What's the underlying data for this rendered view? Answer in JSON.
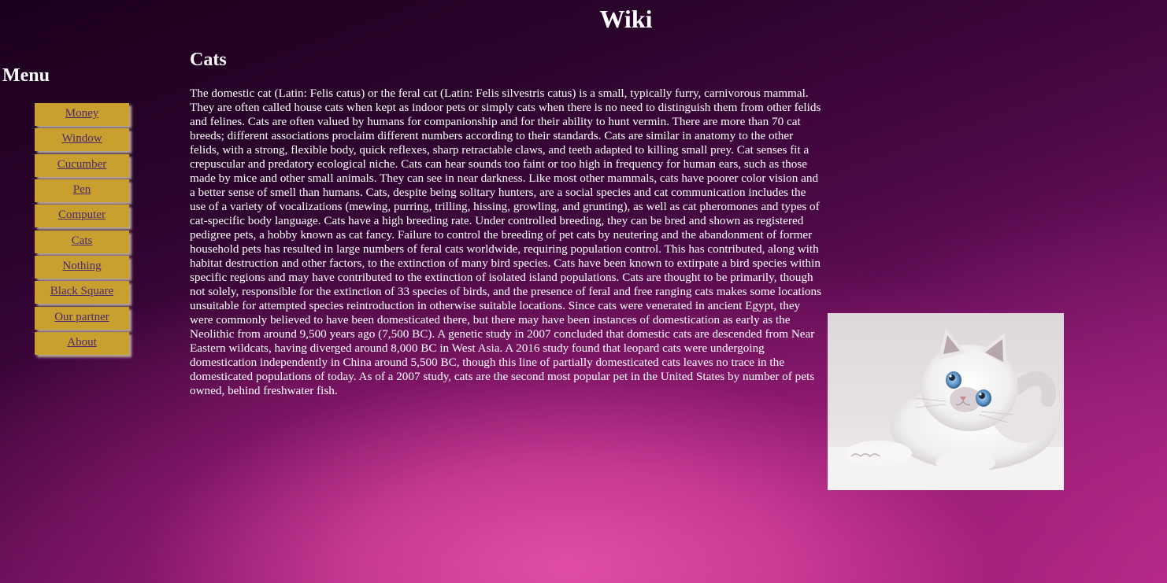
{
  "site": {
    "title": "Wiki"
  },
  "menu": {
    "heading": "Menu",
    "items": [
      {
        "label": "Money"
      },
      {
        "label": "Window"
      },
      {
        "label": "Cucumber"
      },
      {
        "label": "Pen"
      },
      {
        "label": "Computer"
      },
      {
        "label": "Cats"
      },
      {
        "label": "Nothing"
      },
      {
        "label": "Black Square"
      },
      {
        "label": "Our partner"
      },
      {
        "label": "About"
      }
    ]
  },
  "article": {
    "heading": "Cats",
    "body": "The domestic cat (Latin: Felis catus) or the feral cat (Latin: Felis silvestris catus) is a small, typically furry, carnivorous mammal. They are often called house cats when kept as indoor pets or simply cats when there is no need to distinguish them from other felids and felines. Cats are often valued by humans for companionship and for their ability to hunt vermin. There are more than 70 cat breeds; different associations proclaim different numbers according to their standards. Cats are similar in anatomy to the other felids, with a strong, flexible body, quick reflexes, sharp retractable claws, and teeth adapted to killing small prey. Cat senses fit a crepuscular and predatory ecological niche. Cats can hear sounds too faint or too high in frequency for human ears, such as those made by mice and other small animals. They can see in near darkness. Like most other mammals, cats have poorer color vision and a better sense of smell than humans. Cats, despite being solitary hunters, are a social species and cat communication includes the use of a variety of vocalizations (mewing, purring, trilling, hissing, growling, and grunting), as well as cat pheromones and types of cat-specific body language. Cats have a high breeding rate. Under controlled breeding, they can be bred and shown as registered pedigree pets, a hobby known as cat fancy. Failure to control the breeding of pet cats by neutering and the abandonment of former household pets has resulted in large numbers of feral cats worldwide, requiring population control. This has contributed, along with habitat destruction and other factors, to the extinction of many bird species. Cats have been known to extirpate a bird species within specific regions and may have contributed to the extinction of isolated island populations. Cats are thought to be primarily, though not solely, responsible for the extinction of 33 species of birds, and the presence of feral and free ranging cats makes some locations unsuitable for attempted species reintroduction in otherwise suitable locations. Since cats were venerated in ancient Egypt, they were commonly believed to have been domesticated there, but there may have been instances of domestication as early as the Neolithic from around 9,500 years ago (7,500 BC). A genetic study in 2007 concluded that domestic cats are descended from Near Eastern wildcats, having diverged around 8,000 BC in West Asia. A 2016 study found that leopard cats were undergoing domestication independently in China around 5,500 BC, though this line of partially domesticated cats leaves no trace in the domesticated populations of today. As of a 2007 study, cats are the second most popular pet in the United States by number of pets owned, behind freshwater fish.",
    "image": "white-fluffy-kitten-photo"
  },
  "colors": {
    "menu_button_bg": "#c9a030",
    "menu_link": "#4a2a6e",
    "text": "#ffffff",
    "background_dark": "#1c001f",
    "background_pink": "#d6409c"
  }
}
